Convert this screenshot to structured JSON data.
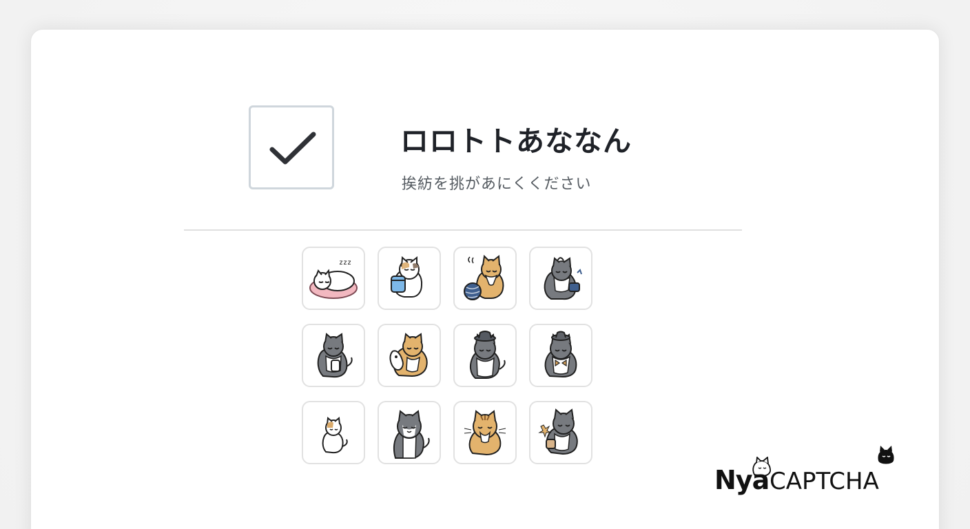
{
  "captcha": {
    "checkbox_checked": true,
    "title": "ロロトトあななん",
    "subtitle": "挨紡を挑があにくください",
    "tiles": [
      {
        "name": "tile-sleeping-cat",
        "icon": "sleeping-cat-icon"
      },
      {
        "name": "tile-cat-with-cup",
        "icon": "cat-cup-icon"
      },
      {
        "name": "tile-cat-with-yarn",
        "icon": "cat-yarn-icon"
      },
      {
        "name": "tile-cat-stirring",
        "icon": "cat-stirring-icon"
      },
      {
        "name": "tile-cat-holding-bottle",
        "icon": "cat-bottle-icon"
      },
      {
        "name": "tile-cat-hugging-toy",
        "icon": "cat-toy-icon"
      },
      {
        "name": "tile-cat-with-hat",
        "icon": "cat-hat-icon"
      },
      {
        "name": "tile-cat-bow-hat",
        "icon": "cat-bow-icon"
      },
      {
        "name": "tile-small-cat",
        "icon": "small-cat-icon"
      },
      {
        "name": "tile-cat-smiling",
        "icon": "cat-smile-icon"
      },
      {
        "name": "tile-cat-tabby",
        "icon": "tabby-cat-icon"
      },
      {
        "name": "tile-cat-with-mug",
        "icon": "cat-mug-icon"
      }
    ]
  },
  "brand": {
    "nya": "Nya",
    "captcha": "CAPTCHA"
  },
  "colors": {
    "checkmark": "#2f3136",
    "title": "#1f2228",
    "subtitle": "#555b61",
    "grey_fur": "#777a7f",
    "orange_fur": "#d6a15a",
    "pink_cushion": "#f2b8c0",
    "blue_yarn": "#3f5f8e"
  }
}
